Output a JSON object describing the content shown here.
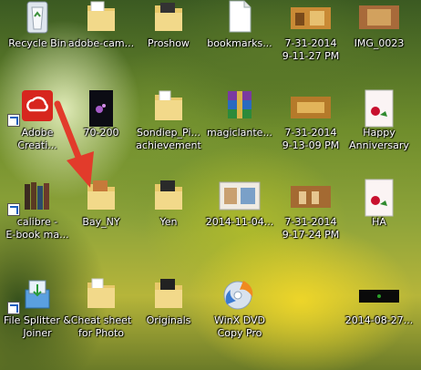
{
  "desktop": {
    "icons": [
      {
        "id": "recycle-bin",
        "label": "Recycle Bin",
        "type": "recycle"
      },
      {
        "id": "adobe-cam",
        "label": "adobe-cam...",
        "type": "folder"
      },
      {
        "id": "proshow",
        "label": "Proshow",
        "type": "folder-photo"
      },
      {
        "id": "bookmarks",
        "label": "bookmarks...",
        "type": "document"
      },
      {
        "id": "img-2014-07-31-21-11",
        "label": "7-31-2014\n9-11-27 PM",
        "type": "photo-thumb"
      },
      {
        "id": "img-0023",
        "label": "IMG_0023",
        "type": "photo-thumb"
      },
      {
        "id": "adobe-creative",
        "label": "Adobe\nCreati...",
        "type": "adobe"
      },
      {
        "id": "70-200",
        "label": "70-200",
        "type": "photo-dark"
      },
      {
        "id": "sondiep-pi",
        "label": "Sondiep_Pi...\nachievement",
        "type": "folder"
      },
      {
        "id": "magiclantern",
        "label": "magiclante...",
        "type": "rar"
      },
      {
        "id": "img-2014-07-31-21-13",
        "label": "7-31-2014\n9-13-09 PM",
        "type": "photo-thumb"
      },
      {
        "id": "happy-anniversary",
        "label": "Happy\nAnniversary",
        "type": "card"
      },
      {
        "id": "calibre",
        "label": "calibre -\nE-book ma...",
        "type": "books"
      },
      {
        "id": "bay-ny",
        "label": "Bay_NY",
        "type": "folder-photo"
      },
      {
        "id": "yen",
        "label": "Yen",
        "type": "folder-photo"
      },
      {
        "id": "img-2014-11-04",
        "label": "2014-11-04...",
        "type": "photo-thumb"
      },
      {
        "id": "img-2014-07-31-21-17",
        "label": "7-31-2014\n9-17-24 PM",
        "type": "photo-thumb"
      },
      {
        "id": "ha",
        "label": "HA",
        "type": "card"
      },
      {
        "id": "file-splitter",
        "label": "File Splitter &\nJoiner",
        "type": "splitter"
      },
      {
        "id": "cheat-sheet",
        "label": "Cheat sheet\nfor Photo",
        "type": "folder"
      },
      {
        "id": "originals",
        "label": "Originals",
        "type": "folder-photo"
      },
      {
        "id": "winx-dvd",
        "label": "WinX DVD\nCopy Pro",
        "type": "dvd"
      },
      {
        "id": "img-2014-08-27",
        "label": "2014-08-27...",
        "type": "photo-dark"
      }
    ]
  },
  "colors": {
    "arrow": "#e23b2b",
    "label_text": "#ffffff"
  }
}
